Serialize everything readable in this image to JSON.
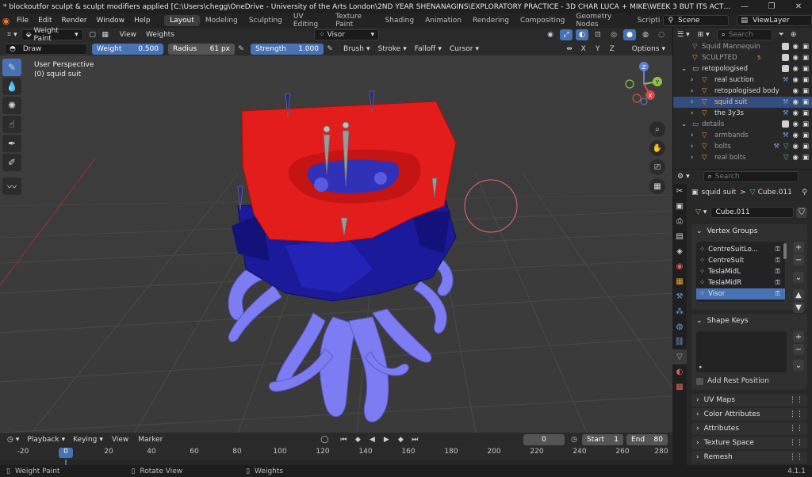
{
  "titlebar": {
    "title": "* blockoutfor sculpt & sculpt modifiers applied [C:\\Users\\chegg\\OneDrive - University of the Arts London\\2ND YEAR SHENANAGINS\\EXPLORATORY PRACTICE - 3D CHAR LUCA + MIKE\\WEEK 3 BUT ITS ACTUALLY EASTER HOLIDAYS IM LAZY\\block...",
    "minimize": "—",
    "maximize": "❐",
    "close": "✕"
  },
  "menu": [
    "File",
    "Edit",
    "Render",
    "Window",
    "Help"
  ],
  "workspaces": [
    "Layout",
    "Modeling",
    "Sculpting",
    "UV Editing",
    "Texture Paint",
    "Shading",
    "Animation",
    "Rendering",
    "Compositing",
    "Geometry Nodes",
    "Scriptin"
  ],
  "active_workspace": "Layout",
  "scene": {
    "label": "Scene"
  },
  "viewlayer": {
    "label": "ViewLayer"
  },
  "header": {
    "mode": "Weight Paint",
    "view": "View",
    "weights": "Weights",
    "vertex_group": "Visor"
  },
  "tool_options": {
    "brush": "Draw",
    "weight_label": "Weight",
    "weight_value": "0.500",
    "radius_label": "Radius",
    "radius_value": "61 px",
    "strength_label": "Strength",
    "strength_value": "1.000",
    "menus": [
      "Brush",
      "Stroke",
      "Falloff",
      "Cursor"
    ],
    "axes": [
      "X",
      "Y",
      "Z"
    ],
    "options": "Options"
  },
  "viewport": {
    "perspective": "User Perspective",
    "object": "(0) squid suit",
    "gizmo": {
      "x": "X",
      "y": "Y",
      "z": "Z"
    }
  },
  "outliner": {
    "search_placeholder": "Search",
    "rows": [
      {
        "label": "Squid Mannequin",
        "type": "collection-item"
      },
      {
        "label": "SCULPTED",
        "type": "collection-item",
        "badge": "5"
      },
      {
        "label": "retopologised",
        "type": "collection"
      },
      {
        "label": "real suction",
        "type": "object"
      },
      {
        "label": "retopologised body",
        "type": "object"
      },
      {
        "label": "squid suit",
        "type": "object",
        "selected": true
      },
      {
        "label": "the 3y3s",
        "type": "object"
      },
      {
        "label": "details",
        "type": "collection"
      },
      {
        "label": "armbands",
        "type": "object"
      },
      {
        "label": "bolts",
        "type": "object"
      },
      {
        "label": "real bolts",
        "type": "object"
      }
    ]
  },
  "properties": {
    "search_placeholder": "Search",
    "breadcrumb_object": "squid suit",
    "breadcrumb_sep": ">",
    "breadcrumb_data": "Cube.011",
    "mesh_name": "Cube.011",
    "vertex_groups_title": "Vertex Groups",
    "vertex_groups": [
      "CentreSuitLo...",
      "CentreSuit",
      "TeslaMidL",
      "TeslaMidR",
      "Visor"
    ],
    "selected_vertex_group": "Visor",
    "shape_keys_title": "Shape Keys",
    "add_rest_position": "Add Rest Position",
    "panels": [
      "UV Maps",
      "Color Attributes",
      "Attributes",
      "Texture Space",
      "Remesh"
    ]
  },
  "timeline": {
    "playback": "Playback",
    "keying": "Keying",
    "view": "View",
    "marker": "Marker",
    "current_frame": "0",
    "start_label": "Start",
    "start_value": "1",
    "end_label": "End",
    "end_value": "80",
    "ticks": [
      "-20",
      "0",
      "20",
      "40",
      "60",
      "80",
      "100",
      "120",
      "140",
      "160",
      "180",
      "200",
      "220",
      "240",
      "260",
      "280"
    ]
  },
  "status": {
    "left": "Weight Paint",
    "middle": "Rotate View",
    "right": "Weights",
    "version": "4.1.1"
  },
  "colors": {
    "accent": "#4772b3",
    "selection": "#334d80",
    "viewport_bg": "#3d3d3d",
    "mesh_red": "#e31c1c",
    "mesh_blue": "#1a1a9a",
    "tentacle": "#7d7cf2"
  }
}
